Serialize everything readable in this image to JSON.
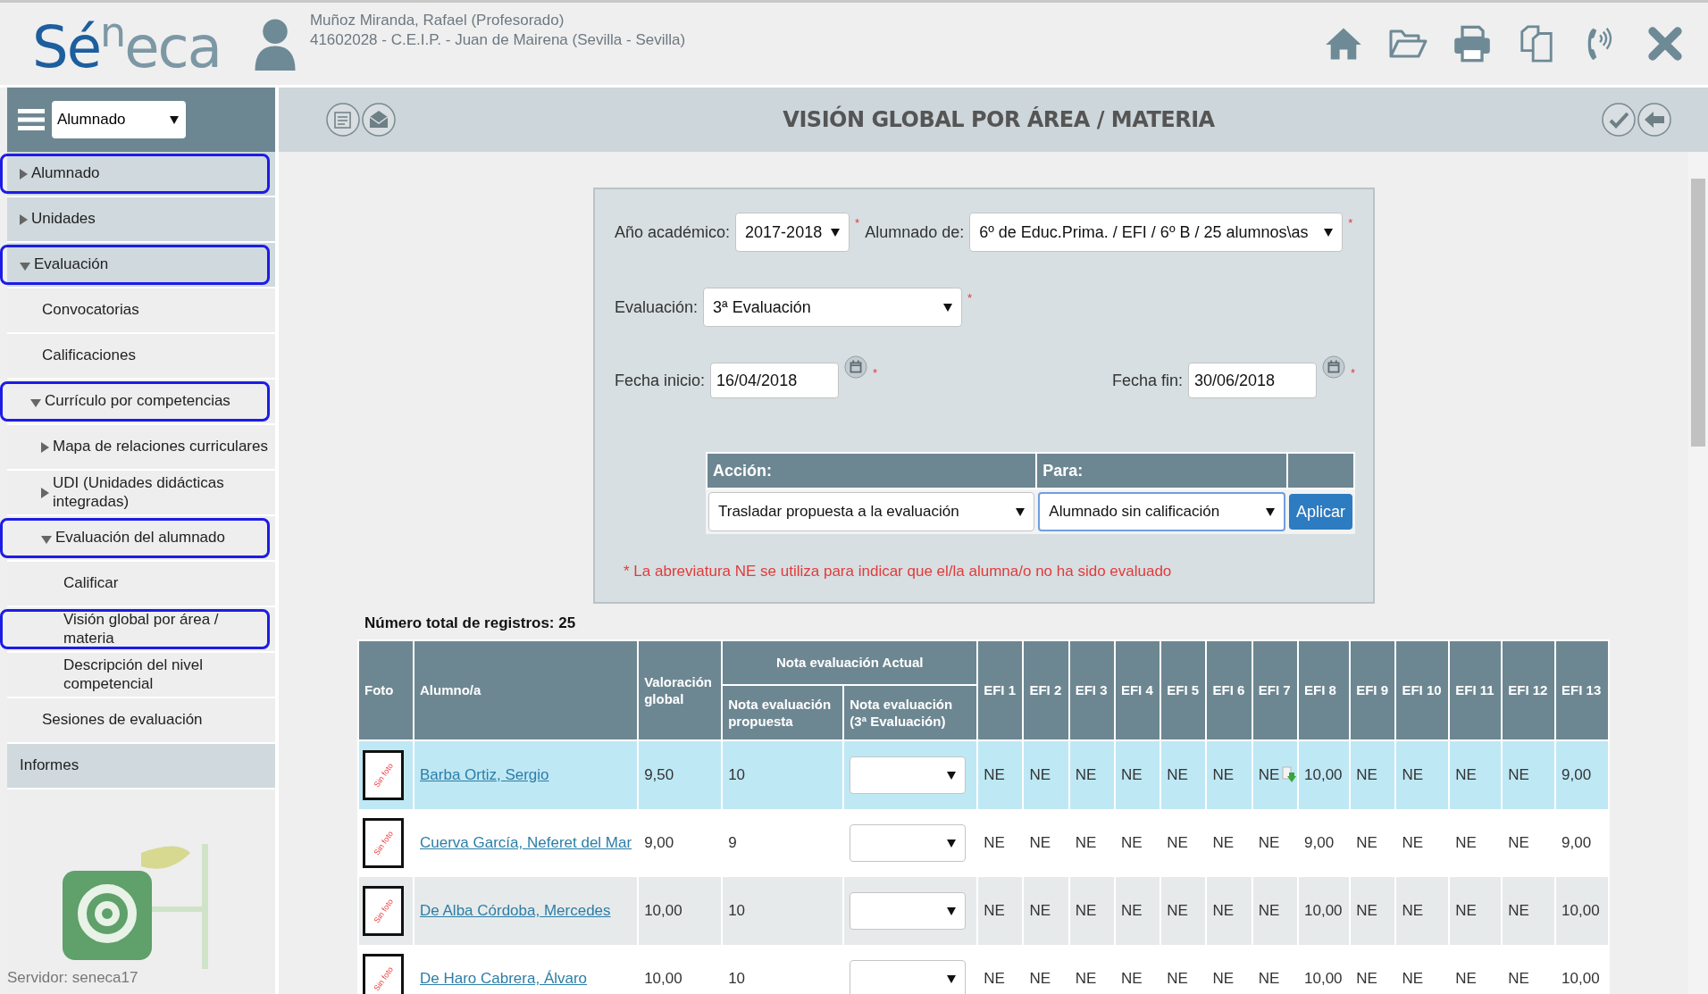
{
  "header": {
    "logo": [
      {
        "text": "Sé",
        "color": "#1d5e9e"
      },
      {
        "text": "n",
        "color": "#7d98a5"
      },
      {
        "text": "eca",
        "color": "#7d98a5"
      }
    ],
    "user": "Muñoz Miranda, Rafael (Profesorado)",
    "school": "41602028 - C.E.I.P. - Juan de Mairena (Sevilla - Sevilla)"
  },
  "sidebar": {
    "module_select": "Alumnado",
    "items": [
      {
        "label": "Alumnado",
        "expanded": false,
        "highlighted": true
      },
      {
        "label": "Unidades",
        "expanded": false,
        "highlighted": false
      },
      {
        "label": "Evaluación",
        "expanded": true,
        "highlighted": true,
        "children": [
          {
            "label": "Convocatorias",
            "highlighted": false
          },
          {
            "label": "Calificaciones",
            "highlighted": false
          },
          {
            "label": "Currículo por competencias",
            "expanded": true,
            "highlighted": true,
            "children": [
              {
                "label": "Mapa de relaciones curriculares",
                "expanded": false,
                "highlighted": false
              },
              {
                "label": "UDI (Unidades didácticas integradas)",
                "expanded": false,
                "highlighted": false
              },
              {
                "label": "Evaluación del alumnado",
                "expanded": true,
                "highlighted": true,
                "children": [
                  {
                    "label": "Calificar",
                    "highlighted": false
                  },
                  {
                    "label": "Visión global por área / materia",
                    "highlighted": true
                  },
                  {
                    "label": "Descripción del nivel competencial",
                    "highlighted": false
                  }
                ]
              }
            ]
          },
          {
            "label": "Sesiones de evaluación",
            "highlighted": false
          }
        ]
      },
      {
        "label": "Informes",
        "highlighted": false
      }
    ],
    "server": "Servidor: seneca17"
  },
  "toolbar": {
    "title": "VISIÓN GLOBAL POR ÁREA / MATERIA"
  },
  "form": {
    "year": {
      "label": "Año académico:",
      "value": "2017-2018",
      "required_mark": "*"
    },
    "group": {
      "label": "Alumnado de:",
      "value": "6º de Educ.Prima. / EFI / 6º B / 25 alumnos\\as",
      "required_mark": "*"
    },
    "evaluation": {
      "label": "Evaluación:",
      "value": "3ª Evaluación",
      "required_mark": "*"
    },
    "start": {
      "label": "Fecha inicio:",
      "value": "16/04/2018",
      "required_mark": "*"
    },
    "end": {
      "label": "Fecha fin:",
      "value": "30/06/2018",
      "required_mark": "*"
    },
    "action": {
      "headers": [
        "Acción:",
        "Para:"
      ],
      "action": {
        "value": "Trasladar propuesta a la evaluación",
        "focused": false
      },
      "target": {
        "value": "Alumnado sin calificación",
        "focused": true
      },
      "button": "Aplicar"
    },
    "note": "* La abreviatura NE se utiliza para indicar que el/la alumna/o no ha sido evaluado"
  },
  "table": {
    "count": "Número total de registros: 25",
    "columns": {
      "photo": "Foto",
      "student": "Alumno/a",
      "global": "Valoración global",
      "group": "Nota evaluación Actual",
      "proposed": "Nota evaluación propuesta",
      "current": "Nota evaluación (3ª Evaluación)",
      "efi": [
        "EFI 1",
        "EFI 2",
        "EFI 3",
        "EFI 4",
        "EFI 5",
        "EFI 6",
        "EFI 7",
        "EFI 8",
        "EFI 9",
        "EFI 10",
        "EFI 11",
        "EFI 12",
        "EFI 13"
      ]
    },
    "rows": [
      {
        "selected": true,
        "photo_label": "Sin foto",
        "name": "Barba Ortiz, Sergio",
        "global": "9,50",
        "proposed": "10",
        "grades": [
          {
            "v": "NE",
            "marked": false
          },
          {
            "v": "NE",
            "marked": false
          },
          {
            "v": "NE",
            "marked": false
          },
          {
            "v": "NE",
            "marked": false
          },
          {
            "v": "NE",
            "marked": false
          },
          {
            "v": "NE",
            "marked": false
          },
          {
            "v": "NE",
            "marked": true
          },
          {
            "v": "10,00",
            "marked": false
          },
          {
            "v": "NE",
            "marked": false
          },
          {
            "v": "NE",
            "marked": false
          },
          {
            "v": "NE",
            "marked": false
          },
          {
            "v": "NE",
            "marked": false
          },
          {
            "v": "9,00",
            "marked": false
          }
        ]
      },
      {
        "selected": false,
        "photo_label": "Sin foto",
        "name": "Cuerva García, Neferet del Mar",
        "global": "9,00",
        "proposed": "9",
        "grades": [
          {
            "v": "NE",
            "marked": false
          },
          {
            "v": "NE",
            "marked": false
          },
          {
            "v": "NE",
            "marked": false
          },
          {
            "v": "NE",
            "marked": false
          },
          {
            "v": "NE",
            "marked": false
          },
          {
            "v": "NE",
            "marked": false
          },
          {
            "v": "NE",
            "marked": false
          },
          {
            "v": "9,00",
            "marked": false
          },
          {
            "v": "NE",
            "marked": false
          },
          {
            "v": "NE",
            "marked": false
          },
          {
            "v": "NE",
            "marked": false
          },
          {
            "v": "NE",
            "marked": false
          },
          {
            "v": "9,00",
            "marked": false
          }
        ]
      },
      {
        "selected": false,
        "photo_label": "Sin foto",
        "name": "De Alba Córdoba, Mercedes",
        "global": "10,00",
        "proposed": "10",
        "grades": [
          {
            "v": "NE",
            "marked": false
          },
          {
            "v": "NE",
            "marked": false
          },
          {
            "v": "NE",
            "marked": false
          },
          {
            "v": "NE",
            "marked": false
          },
          {
            "v": "NE",
            "marked": false
          },
          {
            "v": "NE",
            "marked": false
          },
          {
            "v": "NE",
            "marked": false
          },
          {
            "v": "10,00",
            "marked": false
          },
          {
            "v": "NE",
            "marked": false
          },
          {
            "v": "NE",
            "marked": false
          },
          {
            "v": "NE",
            "marked": false
          },
          {
            "v": "NE",
            "marked": false
          },
          {
            "v": "10,00",
            "marked": false
          }
        ]
      },
      {
        "selected": false,
        "photo_label": "Sin foto",
        "name": "De Haro Cabrera, Álvaro",
        "global": "10,00",
        "proposed": "10",
        "grades": [
          {
            "v": "NE",
            "marked": false
          },
          {
            "v": "NE",
            "marked": false
          },
          {
            "v": "NE",
            "marked": false
          },
          {
            "v": "NE",
            "marked": false
          },
          {
            "v": "NE",
            "marked": false
          },
          {
            "v": "NE",
            "marked": false
          },
          {
            "v": "NE",
            "marked": false
          },
          {
            "v": "10,00",
            "marked": false
          },
          {
            "v": "NE",
            "marked": false
          },
          {
            "v": "NE",
            "marked": false
          },
          {
            "v": "NE",
            "marked": false
          },
          {
            "v": "NE",
            "marked": false
          },
          {
            "v": "10,00",
            "marked": false
          }
        ]
      }
    ]
  }
}
